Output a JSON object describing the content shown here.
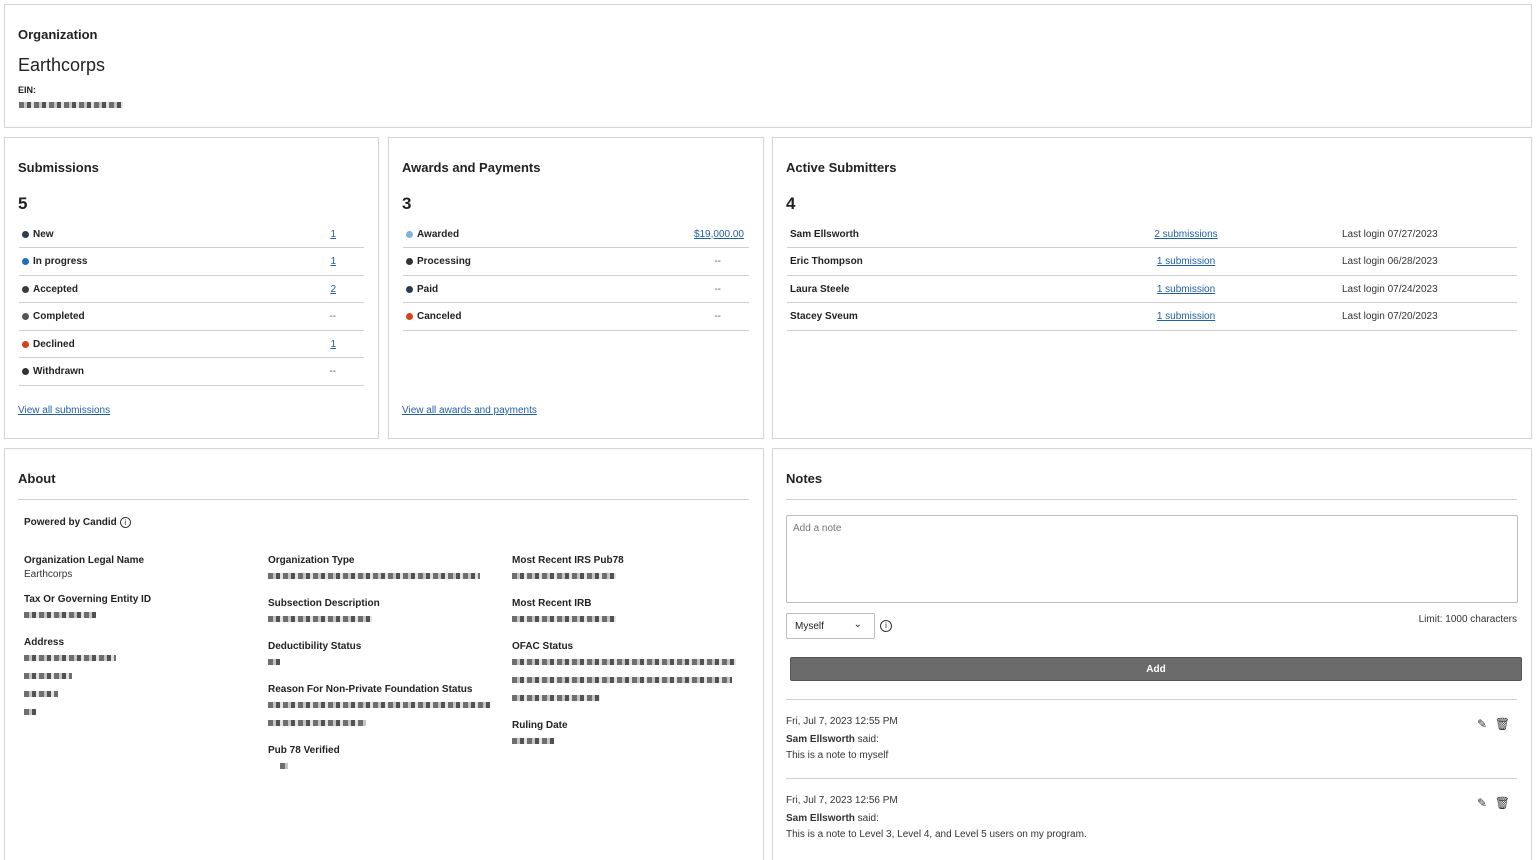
{
  "org": {
    "heading": "Organization",
    "name": "Earthcorps",
    "ein_label": "EIN:"
  },
  "submissions": {
    "title": "Submissions",
    "total": "5",
    "rows": [
      {
        "label": "New",
        "value": "1",
        "color": "#2b3a55",
        "link": true
      },
      {
        "label": "In progress",
        "value": "1",
        "color": "#1f6fb2",
        "link": true
      },
      {
        "label": "Accepted",
        "value": "2",
        "color": "#3a3a3a",
        "link": true
      },
      {
        "label": "Completed",
        "value": "--",
        "color": "#555555",
        "link": false
      },
      {
        "label": "Declined",
        "value": "1",
        "color": "#d4441a",
        "link": true
      },
      {
        "label": "Withdrawn",
        "value": "--",
        "color": "#333333",
        "link": false
      }
    ],
    "view_all": "View all submissions"
  },
  "awards": {
    "title": "Awards and Payments",
    "total": "3",
    "rows": [
      {
        "label": "Awarded",
        "value": "$19,000.00",
        "color": "#7fb3d9",
        "link": true
      },
      {
        "label": "Processing",
        "value": "--",
        "color": "#333333",
        "link": false
      },
      {
        "label": "Paid",
        "value": "--",
        "color": "#2b3a55",
        "link": false
      },
      {
        "label": "Canceled",
        "value": "--",
        "color": "#d4441a",
        "link": false
      }
    ],
    "view_all": "View all awards and payments"
  },
  "submitters": {
    "title": "Active Submitters",
    "total": "4",
    "rows": [
      {
        "name": "Sam Ellsworth",
        "subs": "2 submissions",
        "login": "Last login 07/27/2023"
      },
      {
        "name": "Eric Thompson",
        "subs": "1 submission",
        "login": "Last login 06/28/2023"
      },
      {
        "name": "Laura Steele",
        "subs": "1 submission",
        "login": "Last login 07/24/2023"
      },
      {
        "name": "Stacey Sveum",
        "subs": "1 submission",
        "login": "Last login 07/20/2023"
      }
    ]
  },
  "about": {
    "title": "About",
    "powered": "Powered by Candid",
    "legal_name_label": "Organization Legal Name",
    "legal_name_value": "Earthcorps",
    "tax_id_label": "Tax Or Governing Entity ID",
    "address_label": "Address",
    "org_type_label": "Organization Type",
    "subsection_label": "Subsection Description",
    "deductibility_label": "Deductibility Status",
    "reason_label": "Reason For Non-Private Foundation Status",
    "pub78_verified_label": "Pub 78 Verified",
    "irs_pub78_label": "Most Recent IRS Pub78",
    "irb_label": "Most Recent IRB",
    "ofac_label": "OFAC Status",
    "ruling_label": "Ruling Date"
  },
  "notes": {
    "title": "Notes",
    "placeholder": "Add a note",
    "visibility": "Myself",
    "limit": "Limit: 1000 characters",
    "add_label": "Add",
    "items": [
      {
        "date": "Fri, Jul 7, 2023 12:55 PM",
        "author": "Sam Ellsworth",
        "said": " said:",
        "text": "This is a note to myself"
      },
      {
        "date": "Fri, Jul 7, 2023 12:56 PM",
        "author": "Sam Ellsworth",
        "said": " said:",
        "text": "This is a note to Level 3, Level 4, and Level 5 users on my program."
      }
    ]
  }
}
